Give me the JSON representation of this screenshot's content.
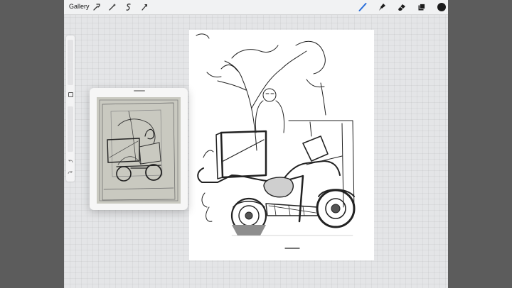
{
  "app": {
    "gallery_label": "Gallery"
  },
  "toolbar": {
    "left_icons": [
      "wrench-icon",
      "magic-wand-icon",
      "selection-icon",
      "transform-arrow-icon"
    ],
    "right_icons": [
      "brush-icon",
      "smudge-icon",
      "eraser-icon",
      "layers-icon",
      "color-picker-icon"
    ],
    "accent_color": "#2a6fdb",
    "active_color": "#1c1c1c"
  },
  "sidebar": {
    "tools": [
      "brush-size-slider",
      "modify-square-button",
      "opacity-slider",
      "undo-icon",
      "redo-icon"
    ]
  },
  "reference": {
    "icon": "reference-image"
  },
  "colors": {
    "outer_background": "#5c5c5c",
    "ipad_background": "#e4e5e7",
    "canvas": "#ffffff",
    "reference_paper": "#c9c9c0"
  }
}
